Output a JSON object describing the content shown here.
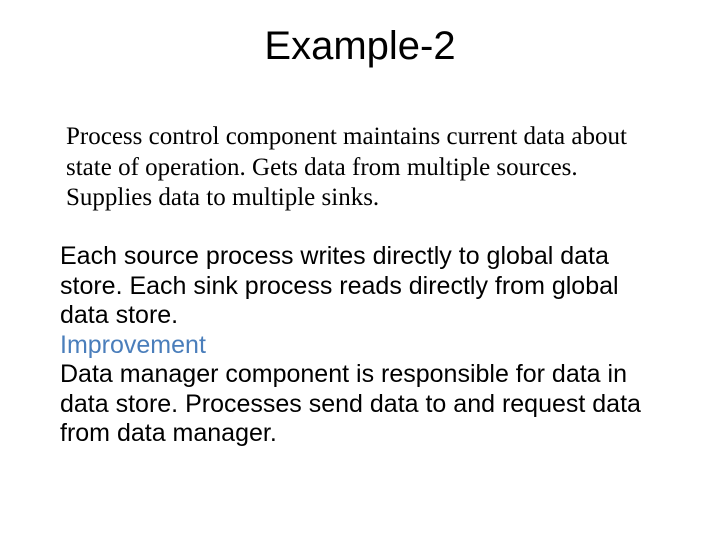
{
  "title": "Example-2",
  "p1": "Process control component maintains current data about state of operation. Gets data from multiple sources. Supplies data to multiple sinks.",
  "p2a": "Each source process writes directly to global data store. Each sink process reads directly from global data store.",
  "improvement_label": "Improvement",
  "p2b": " Data manager component is responsible for data in data store. Processes send data to and request data from data manager."
}
